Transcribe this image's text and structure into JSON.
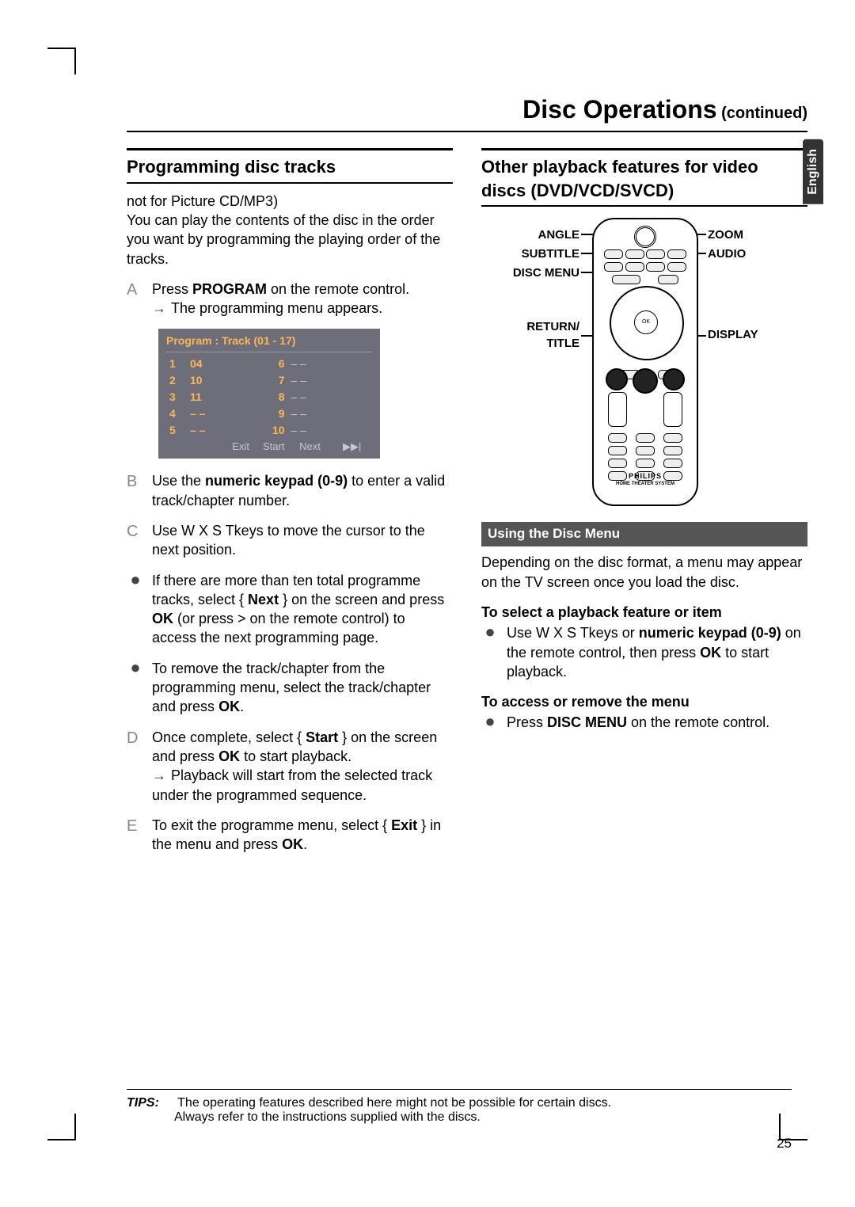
{
  "header": {
    "title": "Disc Operations",
    "sub": " (continued)"
  },
  "lang": "English",
  "page_number": "25",
  "left": {
    "heading": "Programming disc tracks",
    "intro_line1": "not for Picture CD/MP3)",
    "intro_line2": "You can play the contents of the disc in the order you want by programming the playing order of the tracks.",
    "stepA_pre": "Press ",
    "stepA_bold": "PROGRAM",
    "stepA_post": " on the remote control.",
    "stepA_result": "The programming menu appears.",
    "program_header": "Program : Track (01 - 17)",
    "program_rows": [
      {
        "i": "1",
        "v": "04",
        "i2": "6",
        "v2": "– –"
      },
      {
        "i": "2",
        "v": "10",
        "i2": "7",
        "v2": "– –"
      },
      {
        "i": "3",
        "v": "11",
        "i2": "8",
        "v2": "– –"
      },
      {
        "i": "4",
        "v": "– –",
        "i2": "9",
        "v2": "– –"
      },
      {
        "i": "5",
        "v": "– –",
        "i2": "10",
        "v2": "– –"
      }
    ],
    "program_footer": [
      "Exit",
      "Start",
      "Next",
      "▶▶|"
    ],
    "stepB_pre": "Use the ",
    "stepB_bold": "numeric keypad (0-9)",
    "stepB_post": " to enter a valid track/chapter number.",
    "stepC": "Use  W X S Tkeys to move the cursor to the next position.",
    "bullet1_pre": "If there are more than ten total programme tracks, select { ",
    "bullet1_b1": "Next",
    "bullet1_mid": " } on the screen and press ",
    "bullet1_b2": "OK",
    "bullet1_post": " (or press > on the remote control) to access the next programming page.",
    "bullet2_pre": "To remove the track/chapter from the programming menu, select the track/chapter and press ",
    "bullet2_b": "OK",
    "bullet2_post": ".",
    "stepD_pre": "Once complete, select { ",
    "stepD_b1": "Start",
    "stepD_mid": " } on the screen and press ",
    "stepD_b2": "OK",
    "stepD_post": " to start playback.",
    "stepD_result": "Playback will start from the selected track under the programmed sequence.",
    "stepE_pre": "To exit the programme menu, select { ",
    "stepE_b1": "Exit",
    "stepE_mid": " } in the menu and press ",
    "stepE_b2": "OK",
    "stepE_post": "."
  },
  "right": {
    "heading": "Other playback features for video discs (DVD/VCD/SVCD)",
    "labels": {
      "angle": "ANGLE",
      "subtitle": "SUBTITLE",
      "discmenu": "DISC MENU",
      "return_title": "RETURN/\nTITLE",
      "zoom": "ZOOM",
      "audio": "AUDIO",
      "display": "DISPLAY"
    },
    "brand": "PHILIPS",
    "brand_sub": "HOME THEATER SYSTEM",
    "sub_heading": "Using the Disc Menu",
    "discmenu_intro": "Depending on the disc format, a menu may appear on the TV screen once you load the disc.",
    "select_h": "To select a playback feature or item",
    "select_pre": "Use  W X S Tkeys or ",
    "select_b1": "numeric keypad (0-9)",
    "select_mid": " on the remote control, then press ",
    "select_b2": "OK",
    "select_post": " to start playback.",
    "access_h": "To access or remove the menu",
    "access_pre": "Press ",
    "access_b": "DISC MENU",
    "access_post": " on the remote control."
  },
  "tips": {
    "label": "TIPS:",
    "line1": "The operating features described here might not be possible for certain discs.",
    "line2": "Always refer to the instructions supplied with the discs."
  }
}
